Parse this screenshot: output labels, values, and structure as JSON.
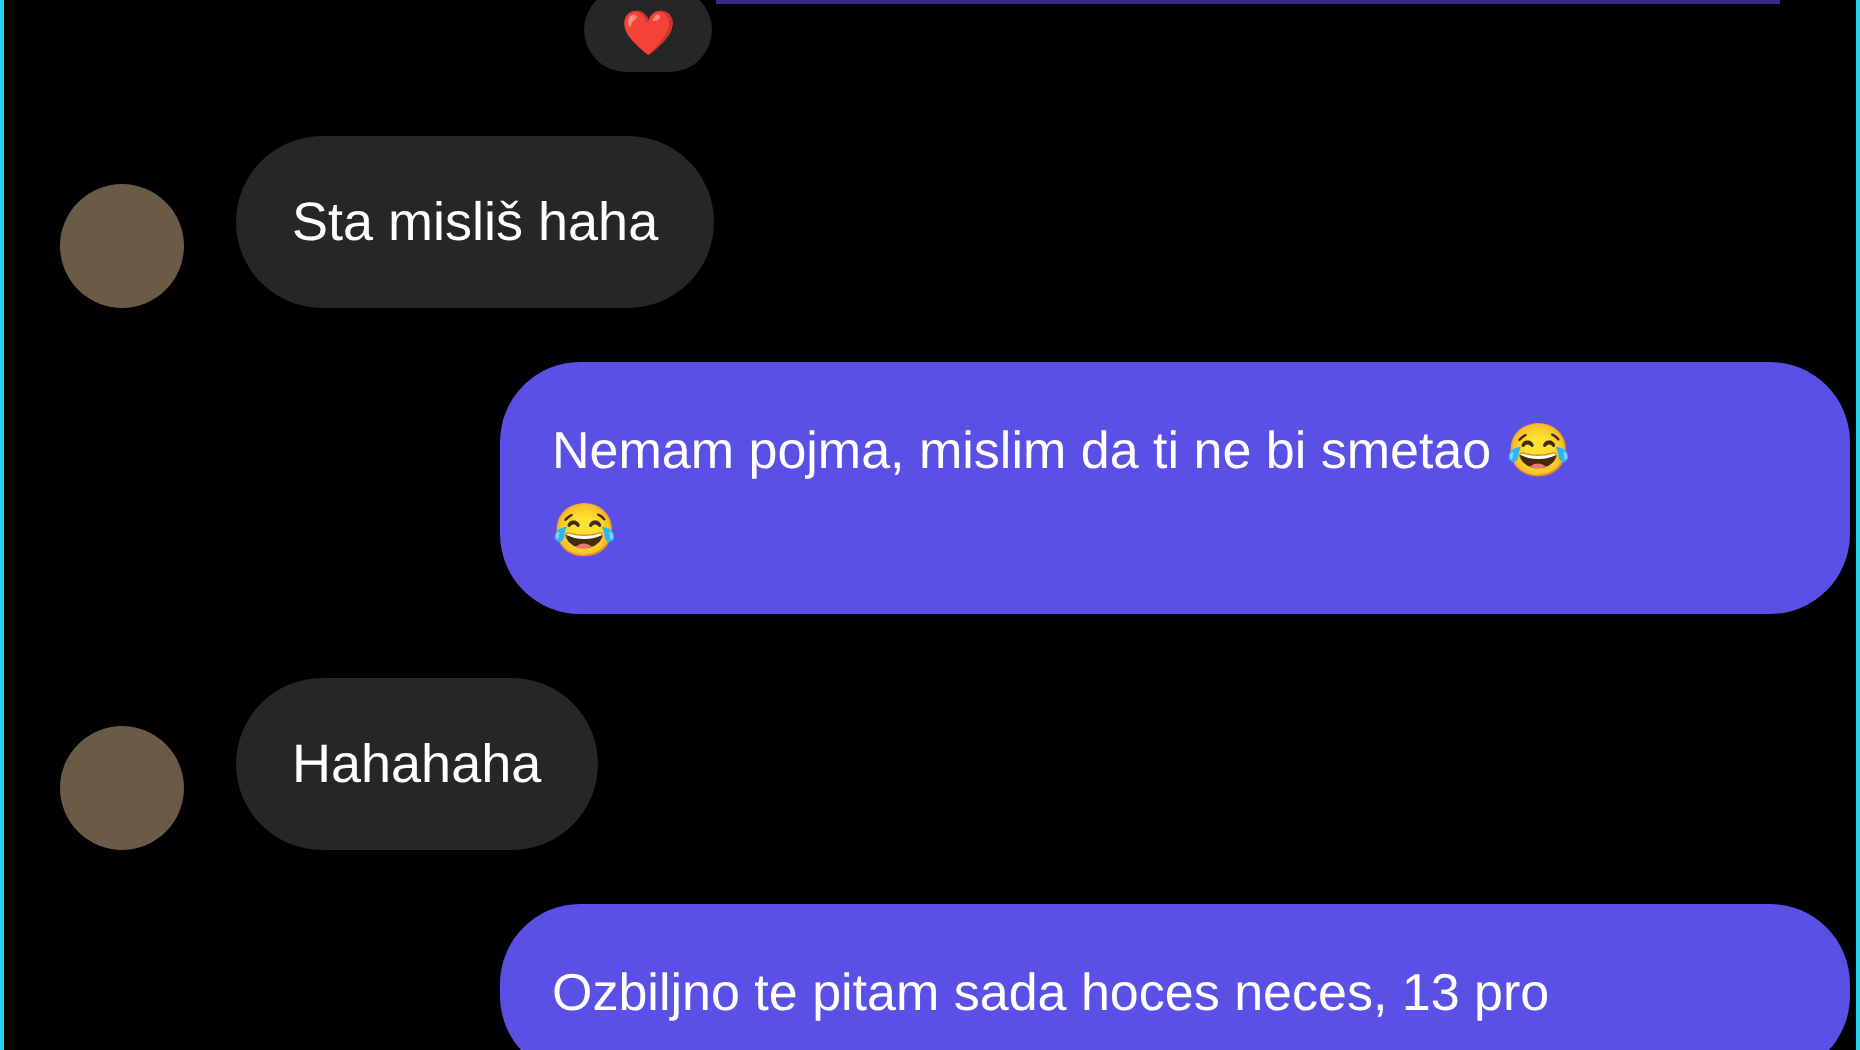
{
  "reaction": {
    "emoji": "❤️"
  },
  "messages": [
    {
      "kind": "incoming",
      "text": "Sta misliš haha"
    },
    {
      "kind": "outgoing",
      "text": "Nemam pojma, mislim da ti ne bi smetao 😂 😂"
    },
    {
      "kind": "incoming",
      "text": "Hahahaha"
    },
    {
      "kind": "outgoing",
      "text": "Ozbiljno te pitam sada hoces neces, 13 pro"
    }
  ]
}
